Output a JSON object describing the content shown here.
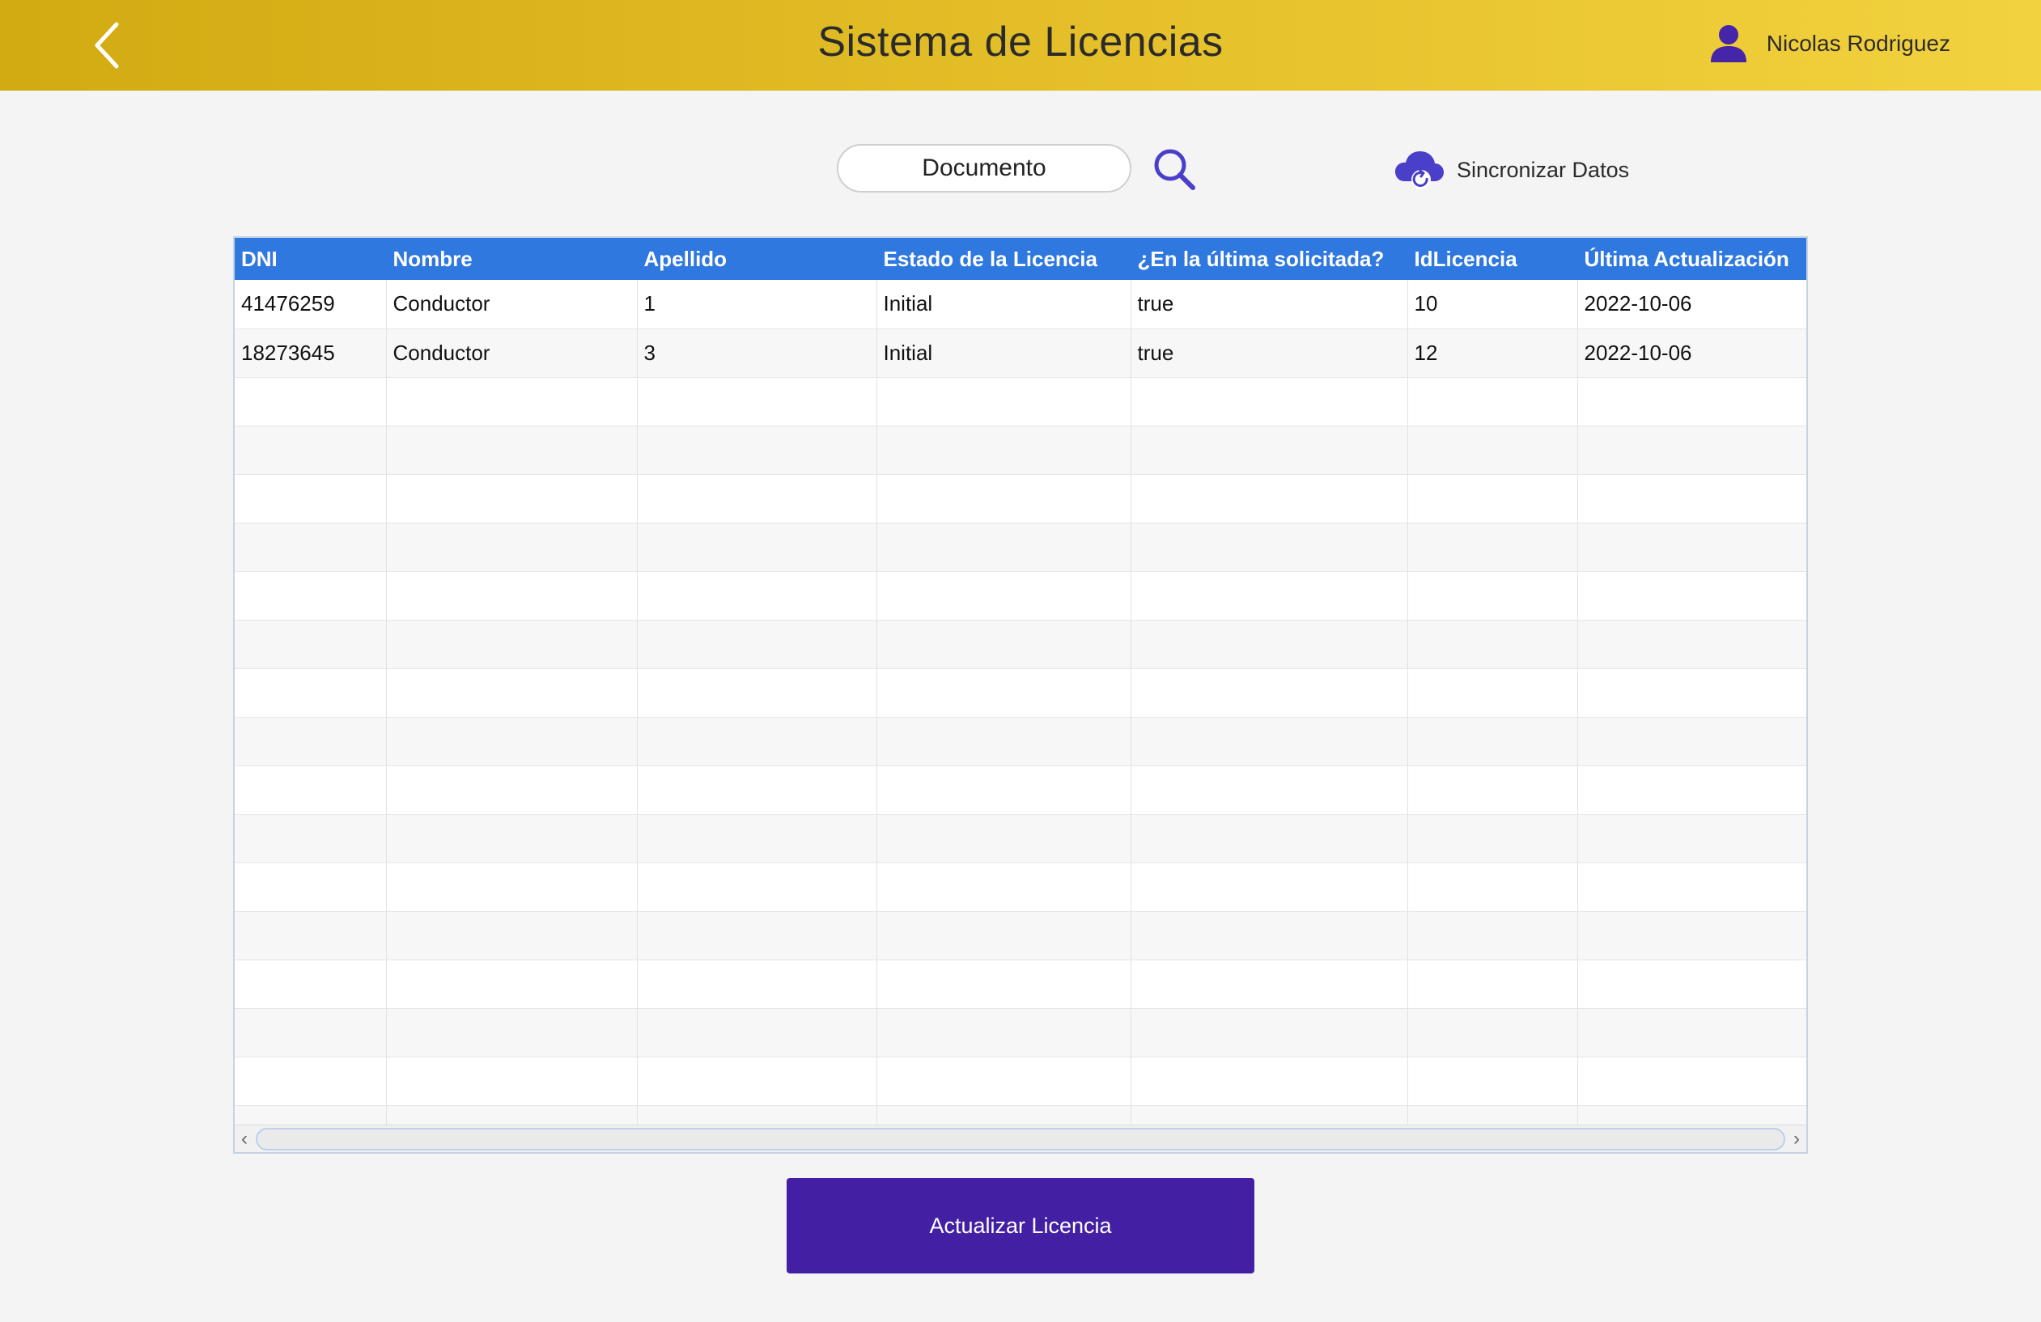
{
  "header": {
    "title": "Sistema de Licencias",
    "user_name": "Nicolas Rodriguez",
    "back_icon": "chevron-left-icon",
    "user_icon": "user-icon"
  },
  "toolbar": {
    "search_value": "Documento",
    "search_icon": "search-icon",
    "sync_label": "Sincronizar Datos",
    "sync_icon": "cloud-sync-icon"
  },
  "table": {
    "columns": [
      "DNI",
      "Nombre",
      "Apellido",
      "Estado de la Licencia",
      "¿En la última solicitada?",
      "IdLicencia",
      "Última Actualización"
    ],
    "rows": [
      [
        "41476259",
        "Conductor",
        "1",
        "Initial",
        "true",
        "10",
        "2022-10-06"
      ],
      [
        "18273645",
        "Conductor",
        "3",
        "Initial",
        "true",
        "12",
        "2022-10-06"
      ]
    ]
  },
  "actions": {
    "update_label": "Actualizar Licencia"
  },
  "colors": {
    "header_gradient_start": "#d2aa12",
    "header_gradient_end": "#f2d23f",
    "table_header": "#2f78e0",
    "primary_button": "#431fa3",
    "icon_accent": "#4a3fc9"
  }
}
